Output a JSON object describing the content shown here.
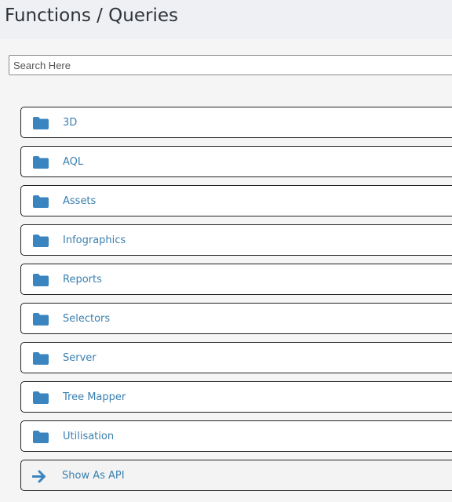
{
  "header": {
    "title": "Functions / Queries"
  },
  "search": {
    "placeholder": "Search Here",
    "value": ""
  },
  "folders": [
    {
      "label": "3D",
      "icon": "folder-icon"
    },
    {
      "label": "AQL",
      "icon": "folder-icon"
    },
    {
      "label": "Assets",
      "icon": "folder-icon"
    },
    {
      "label": "Infographics",
      "icon": "folder-icon"
    },
    {
      "label": "Reports",
      "icon": "folder-icon"
    },
    {
      "label": "Selectors",
      "icon": "folder-icon"
    },
    {
      "label": "Server",
      "icon": "folder-icon"
    },
    {
      "label": "Tree Mapper",
      "icon": "folder-icon"
    },
    {
      "label": "Utilisation",
      "icon": "folder-icon"
    }
  ],
  "api_link": {
    "label": "Show As API",
    "icon": "arrow-right-icon"
  },
  "colors": {
    "accent": "#3a7fb0",
    "icon": "#3a85c0",
    "header_bg": "#eef0f4"
  }
}
